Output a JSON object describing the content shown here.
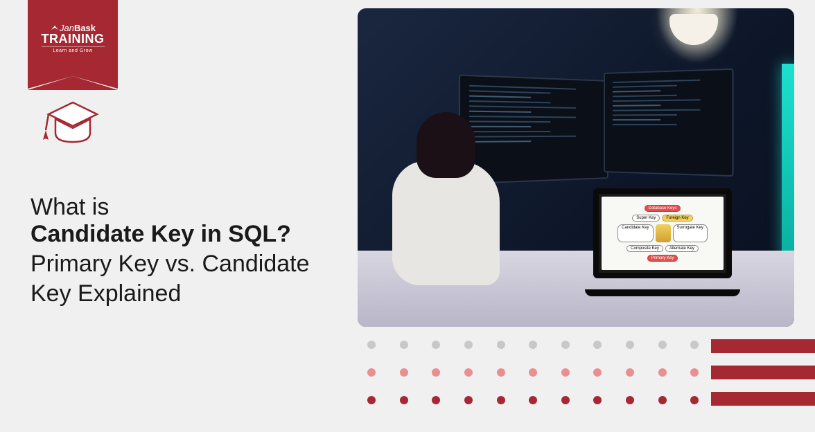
{
  "brand": {
    "prefix": "Jan",
    "suffix": "Bask",
    "main": "TRAINING",
    "tagline": "Learn and Grow"
  },
  "headline": {
    "line1": "What is",
    "line2": "Candidate Key in SQL?",
    "line3": "Primary Key vs. Candidate Key Explained"
  },
  "laptop_keys": {
    "top": "Database Keys",
    "left": [
      "Super Key",
      "Candidate Key",
      "Composite Key"
    ],
    "right": [
      "Foreign Key",
      "Surrogate Key",
      "Alternate Key"
    ],
    "bottom": "Primary Key"
  },
  "colors": {
    "brand": "#a52832",
    "background": "#f0f0f0"
  }
}
